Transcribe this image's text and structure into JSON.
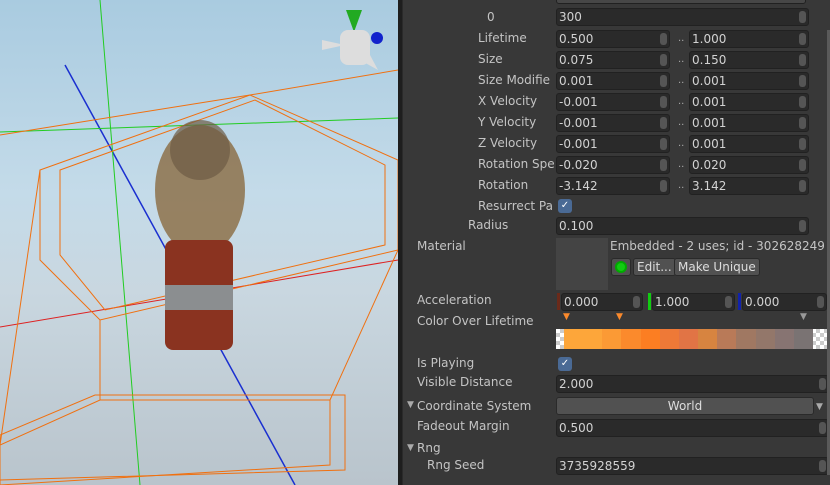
{
  "inspector": {
    "top_value": "300",
    "top_label": "0",
    "rows": [
      {
        "label": "Lifetime",
        "min": "0.500",
        "max": "1.000"
      },
      {
        "label": "Size",
        "min": "0.075",
        "max": "0.150"
      },
      {
        "label": "Size Modifie",
        "min": "0.001",
        "max": "0.001"
      },
      {
        "label": "X Velocity",
        "min": "-0.001",
        "max": "0.001"
      },
      {
        "label": "Y Velocity",
        "min": "-0.001",
        "max": "0.001"
      },
      {
        "label": "Z Velocity",
        "min": "-0.001",
        "max": "0.001"
      },
      {
        "label": "Rotation Spe",
        "min": "-0.020",
        "max": "0.020"
      },
      {
        "label": "Rotation",
        "min": "-3.142",
        "max": "3.142"
      }
    ],
    "range_sep": "..",
    "resurrect_label": "Resurrect Pa",
    "check": "✓",
    "radius_label": "Radius",
    "radius": "0.100",
    "material_label": "Material",
    "material_info": "Embedded - 2 uses; id - 302628249",
    "edit_button": "Edit...",
    "make_unique_button": "Make Unique",
    "acceleration_label": "Acceleration",
    "accel": [
      "0.000",
      "1.000",
      "0.000"
    ],
    "color_label": "Color Over Lifetime",
    "gradient_colors": [
      "#fda63a",
      "#fda63a",
      "#fb9a35",
      "#fb8a2c",
      "#fc7e22",
      "#ee7937",
      "#e17445",
      "#d78440",
      "#b97a58",
      "#a07862",
      "#93776a",
      "#877472",
      "#7a7373"
    ],
    "is_playing_label": "Is Playing",
    "visible_distance_label": "Visible Distance",
    "visible_distance": "2.000",
    "coord_label": "Coordinate System",
    "coord_value": "World",
    "fadeout_label": "Fadeout Margin",
    "fadeout": "0.500",
    "rng_label": "Rng",
    "rng_seed_label": "Rng Seed",
    "rng_seed": "3735928559"
  }
}
